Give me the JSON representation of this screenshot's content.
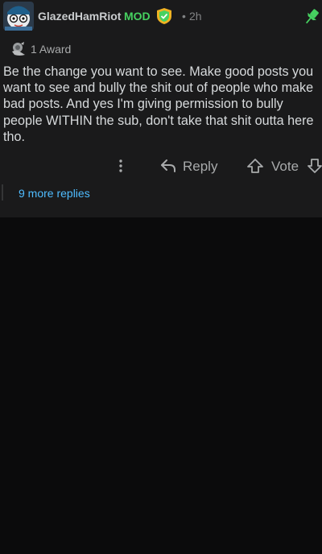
{
  "comment": {
    "username": "GlazedHamRiot",
    "mod_label": "MOD",
    "separator": "•",
    "timestamp": "2h",
    "award_label": "1 Award",
    "body": "Be the change you want to see. Make good posts you want to see and bully the shit out of people who make bad posts. And yes I'm giving permission to bully people WITHIN the sub, don't take that shit outta here tho.",
    "pinned": true
  },
  "actions": {
    "more_icon": "vertical-ellipsis-icon",
    "reply_label": "Reply",
    "vote_label": "Vote"
  },
  "thread": {
    "more_replies_label": "9 more replies"
  },
  "colors": {
    "background": "#0b0b0c",
    "card": "#1a1a1b",
    "mod_green": "#46d160",
    "link_blue": "#4fbcff",
    "pin_green": "#46d160"
  }
}
